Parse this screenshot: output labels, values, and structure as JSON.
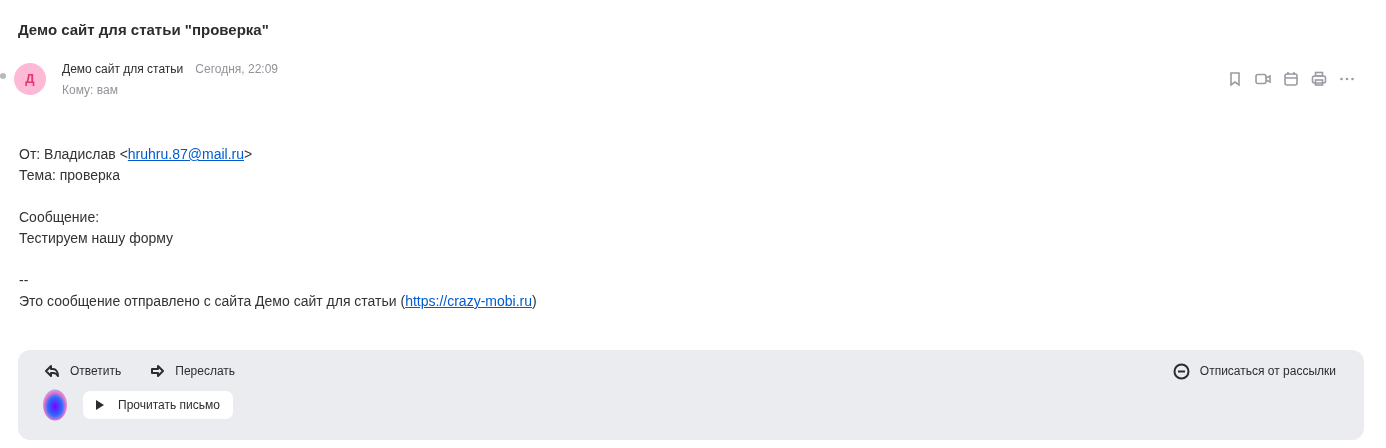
{
  "subject": "Демо сайт для статьи \"проверка\"",
  "message": {
    "avatar_letter": "Д",
    "sender": "Демо сайт для статьи",
    "date": "Сегодня, 22:09",
    "recipient": "Кому: вам"
  },
  "body": [
    {
      "kind": "link_line",
      "before": "От: Владислав <",
      "link": "hruhru.87@mail.ru",
      "after": ">"
    },
    {
      "kind": "text",
      "text": "Тема: проверка"
    },
    {
      "kind": "blank"
    },
    {
      "kind": "text",
      "text": "Сообщение:"
    },
    {
      "kind": "text",
      "text": "Тестируем нашу форму"
    },
    {
      "kind": "blank"
    },
    {
      "kind": "text",
      "text": "--"
    },
    {
      "kind": "link_line",
      "before": "Это сообщение отправлено с сайта Демо сайт для статьи (",
      "link": "https://crazy-mobi.ru",
      "after": ")"
    }
  ],
  "actions": {
    "reply": "Ответить",
    "forward": "Переслать",
    "unsubscribe": "Отписаться от рассылки",
    "read_aloud": "Прочитать письмо"
  }
}
